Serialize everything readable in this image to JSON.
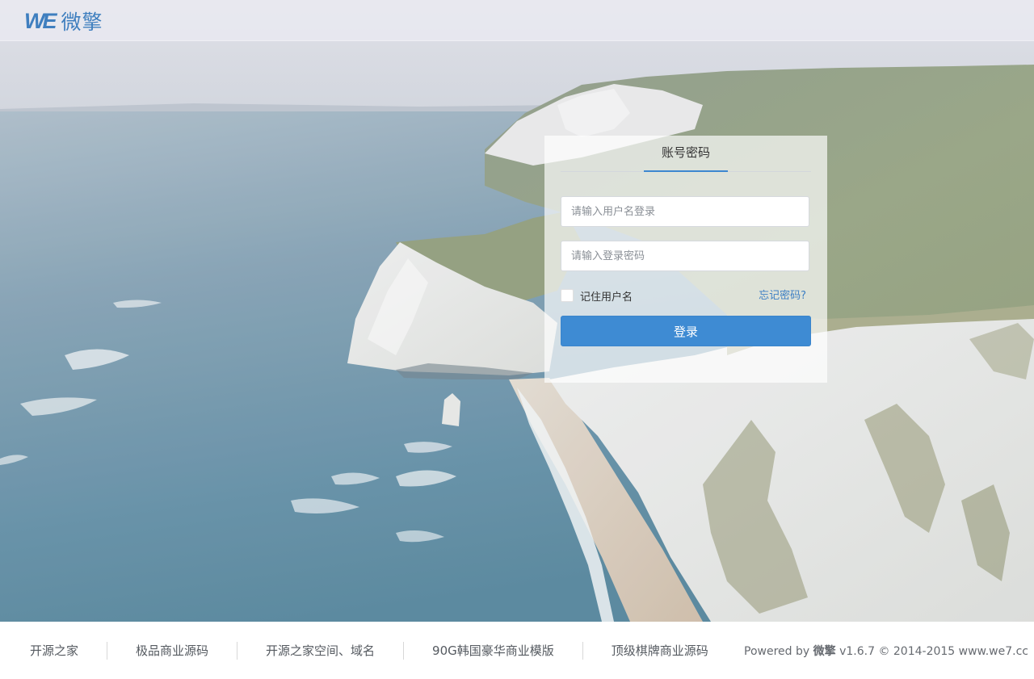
{
  "header": {
    "logo_mark": "WE",
    "logo_text": "微擎"
  },
  "login": {
    "tab_label": "账号密码",
    "username_placeholder": "请输入用户名登录",
    "password_placeholder": "请输入登录密码",
    "remember_label": "记住用户名",
    "remember_checked": false,
    "forgot_label": "忘记密码?",
    "submit_label": "登录"
  },
  "footer": {
    "links": [
      {
        "label": "开源之家"
      },
      {
        "label": "极品商业源码"
      },
      {
        "label": "开源之家空间、域名"
      },
      {
        "label": "90G韩国豪华商业模版"
      },
      {
        "label": "顶级棋牌商业源码"
      }
    ],
    "powered_prefix": "Powered by",
    "powered_brand": "微擎",
    "version": "v1.6.7",
    "copyright": "© 2014-2015",
    "site": "www.we7.cc"
  },
  "colors": {
    "accent": "#3e8bd3",
    "brand": "#3f7fbf",
    "link": "#3d7fc4"
  },
  "icons": {
    "logo": "we7-logo-icon",
    "checkbox": "checkbox-icon"
  }
}
